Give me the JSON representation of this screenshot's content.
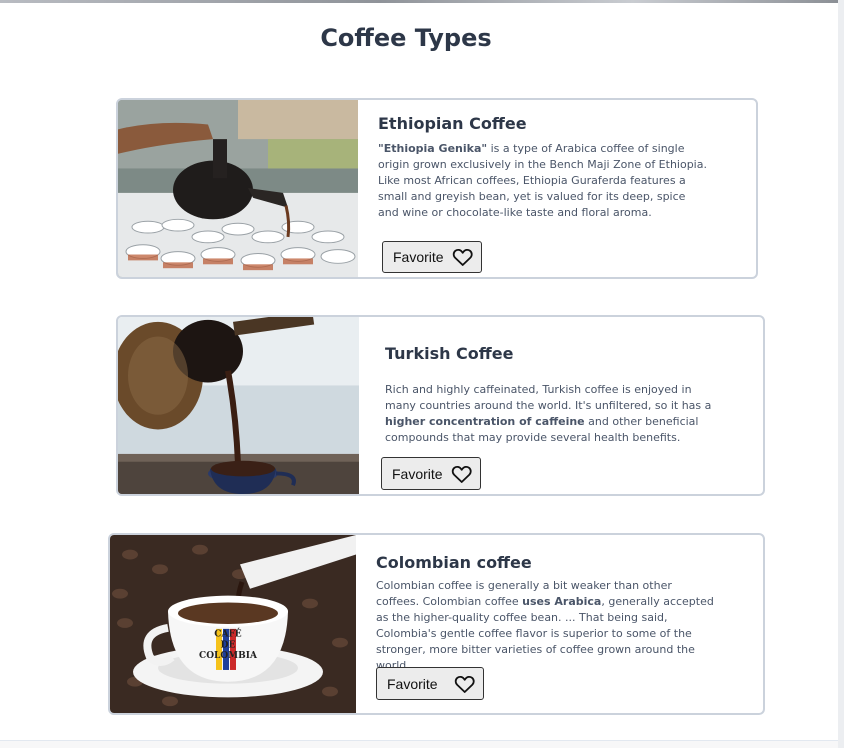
{
  "page": {
    "title": "Coffee Types"
  },
  "cards": [
    {
      "title": "Ethiopian Coffee",
      "desc_lead_bold": "\"Ethiopia Genika\"",
      "desc_rest": " is a type of Arabica coffee of single origin grown exclusively in the Bench Maji Zone of Ethiopia. Like most African coffees, Ethiopia Guraferda features a small and greyish bean, yet is valued for its deep, spice and wine or chocolate-like taste and floral aroma.",
      "button": "Favorite",
      "button_icon": "heart-outline-icon"
    },
    {
      "title": "Turkish Coffee",
      "desc_a": "Rich and highly caffeinated, Turkish coffee is enjoyed in many countries around the world. It's unfiltered, so it has a ",
      "desc_bold": "higher concentration of caffeine",
      "desc_b": " and other beneficial compounds that may provide several health benefits.",
      "button": "Favorite",
      "button_icon": "heart-outline-icon"
    },
    {
      "title": "Colombian coffee",
      "desc_a": "Colombian coffee is generally a bit weaker than other coffees. Colombian coffee ",
      "desc_bold": "uses Arabica",
      "desc_b": ", generally accepted as the higher-quality coffee bean. ... That being said, Colombia's gentle coffee flavor is superior to some of the stronger, more bitter varieties of coffee grown around the world.",
      "button": "Favorite",
      "button_icon": "heart-outline-icon",
      "cup_text": "CAFÉ DE COLOMBIA"
    }
  ]
}
